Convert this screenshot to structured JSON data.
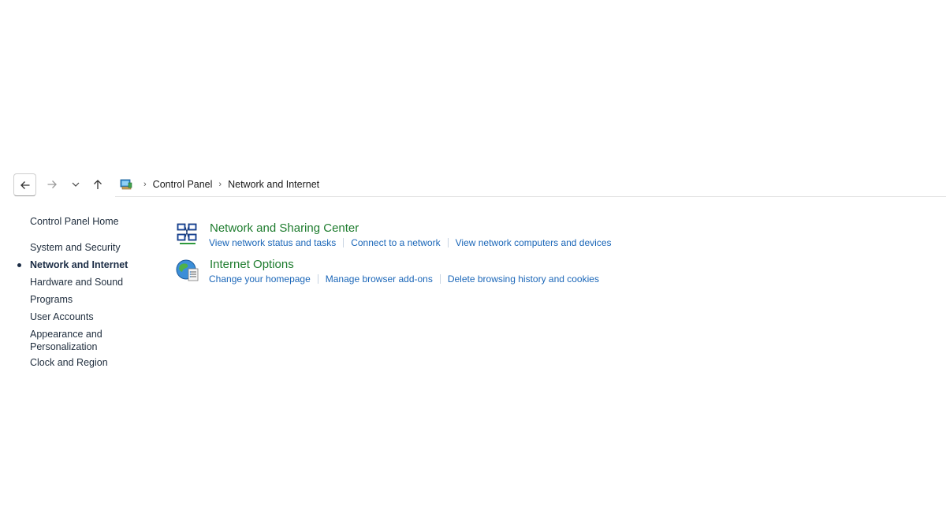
{
  "breadcrumb": {
    "items": [
      "Control Panel",
      "Network and Internet"
    ]
  },
  "sidebar": {
    "home": "Control Panel Home",
    "items": [
      {
        "label": "System and Security"
      },
      {
        "label": "Network and Internet",
        "active": true
      },
      {
        "label": "Hardware and Sound"
      },
      {
        "label": "Programs"
      },
      {
        "label": "User Accounts"
      },
      {
        "label": "Appearance and Personalization"
      },
      {
        "label": "Clock and Region"
      }
    ]
  },
  "categories": [
    {
      "title": "Network and Sharing Center",
      "icon": "network-sharing-icon",
      "links": [
        "View network status and tasks",
        "Connect to a network",
        "View network computers and devices"
      ]
    },
    {
      "title": "Internet Options",
      "icon": "internet-options-icon",
      "links": [
        "Change your homepage",
        "Manage browser add-ons",
        "Delete browsing history and cookies"
      ]
    }
  ],
  "colors": {
    "category_title": "#1e7c2e",
    "link": "#1a66b8",
    "sidebar_text": "#1f2d3d"
  }
}
